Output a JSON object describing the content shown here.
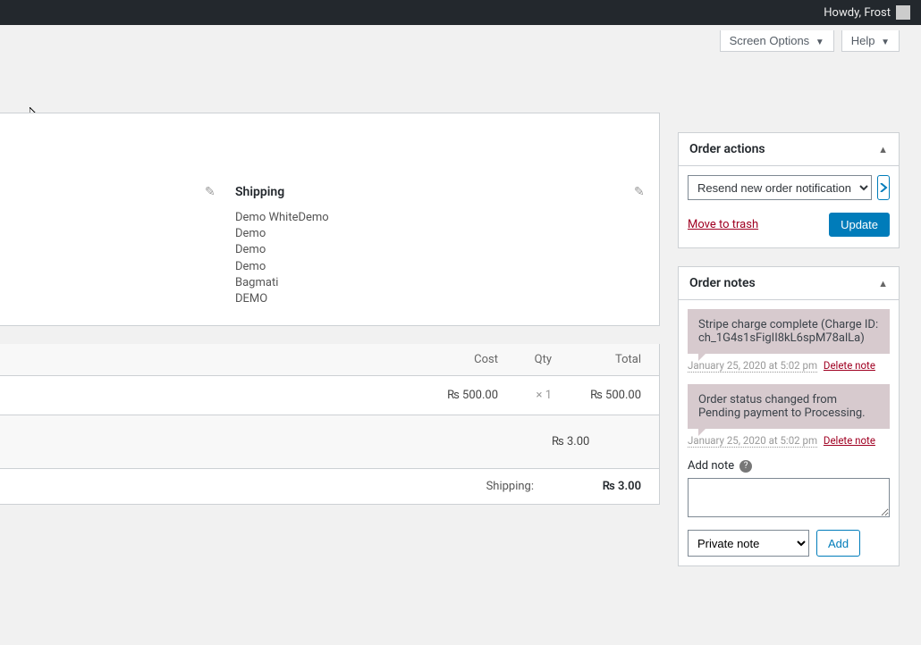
{
  "admin_bar": {
    "greeting": "Howdy, Frost"
  },
  "top_buttons": {
    "screen_options": "Screen Options",
    "help": "Help"
  },
  "shipping": {
    "heading": "Shipping",
    "lines": [
      "Demo WhiteDemo",
      "Demo",
      "Demo",
      "Demo",
      "Bagmati",
      "DEMO"
    ]
  },
  "items_table": {
    "headers": {
      "cost": "Cost",
      "qty": "Qty",
      "total": "Total"
    },
    "row": {
      "cost": "₨ 500.00",
      "qty_prefix": "×",
      "qty": "1",
      "total": "₨ 500.00"
    },
    "shipping_total": "₨ 3.00"
  },
  "totals": {
    "label": "Shipping:",
    "value": "₨ 3.00"
  },
  "order_actions": {
    "title": "Order actions",
    "selected": "Resend new order notification",
    "move_to_trash": "Move to trash",
    "update": "Update"
  },
  "order_notes": {
    "title": "Order notes",
    "notes": [
      {
        "text": "Stripe charge complete (Charge ID: ch_1G4s1sFigII8kL6spM78alLa)",
        "date": "January 25, 2020 at 5:02 pm",
        "delete": "Delete note"
      },
      {
        "text": "Order status changed from Pending payment to Processing.",
        "date": "January 25, 2020 at 5:02 pm",
        "delete": "Delete note"
      }
    ],
    "add_label": "Add note",
    "note_type": "Private note",
    "add_button": "Add"
  }
}
